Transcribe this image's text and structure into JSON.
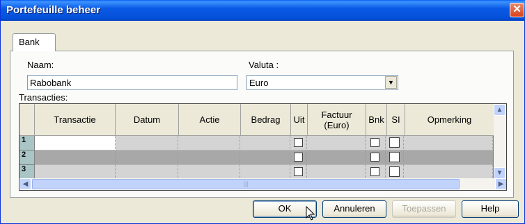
{
  "window": {
    "title": "Portefeuille beheer",
    "close_symbol": "✕"
  },
  "tabs": [
    {
      "label": "Bank"
    }
  ],
  "form": {
    "naam_label": "Naam:",
    "naam_value": "Rabobank",
    "valuta_label": "Valuta :",
    "valuta_value": "Euro",
    "transacties_label": "Transacties:"
  },
  "grid": {
    "columns": [
      "Transactie",
      "Datum",
      "Actie",
      "Bedrag",
      "Uit",
      "Factuur\n(Euro)",
      "Bnk",
      "SI",
      "Opmerking"
    ],
    "rows": [
      {
        "num": "1"
      },
      {
        "num": "2"
      },
      {
        "num": "3"
      }
    ]
  },
  "buttons": {
    "ok": "OK",
    "cancel": "Annuleren",
    "apply": "Toepassen",
    "help": "Help"
  },
  "icons": {
    "scroll_up": "▲",
    "scroll_down": "▼",
    "scroll_left": "◀",
    "scroll_right": "▶",
    "dropdown": "▼"
  },
  "colors": {
    "titlebar": "#0450d8",
    "dialog_bg": "#ece9d8",
    "row_number_bg": "#a9c5c5"
  }
}
